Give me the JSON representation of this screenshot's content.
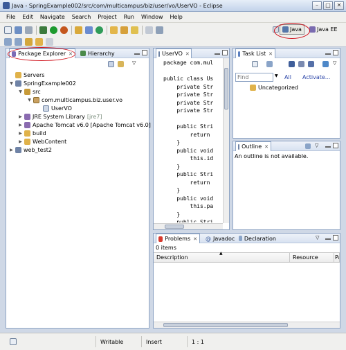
{
  "window": {
    "title": "Java - SpringExample002/src/com/multicampus/biz/user/vo/UserVO - Eclipse"
  },
  "menu": [
    "File",
    "Edit",
    "Navigate",
    "Search",
    "Project",
    "Run",
    "Window",
    "Help"
  ],
  "perspectives": {
    "java": "Java",
    "javaee": "Java EE"
  },
  "package_explorer": {
    "tab_label": "Package Explorer",
    "other_tab": "Hierarchy",
    "tree": {
      "servers": "Servers",
      "project": "SpringExample002",
      "src": "src",
      "package": "com.multicampus.biz.user.vo",
      "class": "UserVO",
      "jre": "JRE System Library",
      "jre_tag": "[jre7]",
      "tomcat": "Apache Tomcat v6.0 [Apache Tomcat v6.0]",
      "build": "build",
      "webcontent": "WebContent",
      "web_test2": "web_test2"
    }
  },
  "editor": {
    "tab_label": "UserVO",
    "lines": [
      "package com.mul",
      "",
      "public class Us",
      "    private Str",
      "    private Str",
      "    private Str",
      "    private Str",
      "",
      "    public Stri",
      "        return",
      "    }",
      "    public void",
      "        this.id",
      "    }",
      "    public Stri",
      "        return",
      "    }",
      "    public void",
      "        this.pa",
      "    }",
      "    public Stri"
    ]
  },
  "task_list": {
    "tab_label": "Task List",
    "find_placeholder": "Find",
    "all": "All",
    "activate": "Activate...",
    "category": "Uncategorized"
  },
  "outline": {
    "tab_label": "Outline",
    "message": "An outline is not available."
  },
  "problems": {
    "tabs": [
      "Problems",
      "Javadoc",
      "Declaration"
    ],
    "count": "0 items",
    "columns": [
      "Description",
      "Resource",
      "Pa"
    ]
  },
  "status": {
    "writable": "Writable",
    "insert": "Insert",
    "position": "1 : 1"
  },
  "colors": {
    "accent": "#d0121b",
    "frame": "#8ea4c4"
  }
}
